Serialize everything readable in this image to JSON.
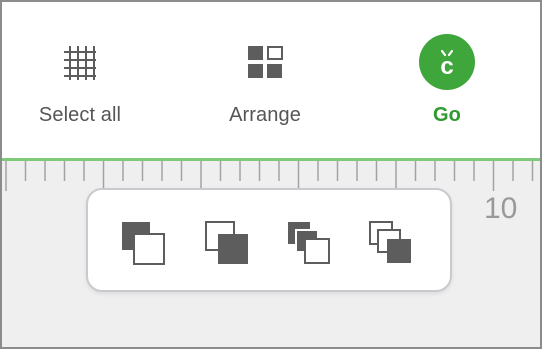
{
  "toolbar": {
    "select_all_label": "Select all",
    "arrange_label": "Arrange",
    "go_label": "Go",
    "go_badge_letter": "c"
  },
  "ruler": {
    "number_label": "10"
  },
  "colors": {
    "accent_green": "#3ea63b",
    "go_text_green": "#2f9a2f",
    "icon_gray": "#5d5d5d",
    "canvas_bg": "#efeff0"
  },
  "arrange_popover": {
    "options": [
      {
        "icon": "bring-to-front-icon"
      },
      {
        "icon": "send-to-back-icon"
      },
      {
        "icon": "bring-forward-icon"
      },
      {
        "icon": "send-backward-icon"
      }
    ]
  }
}
